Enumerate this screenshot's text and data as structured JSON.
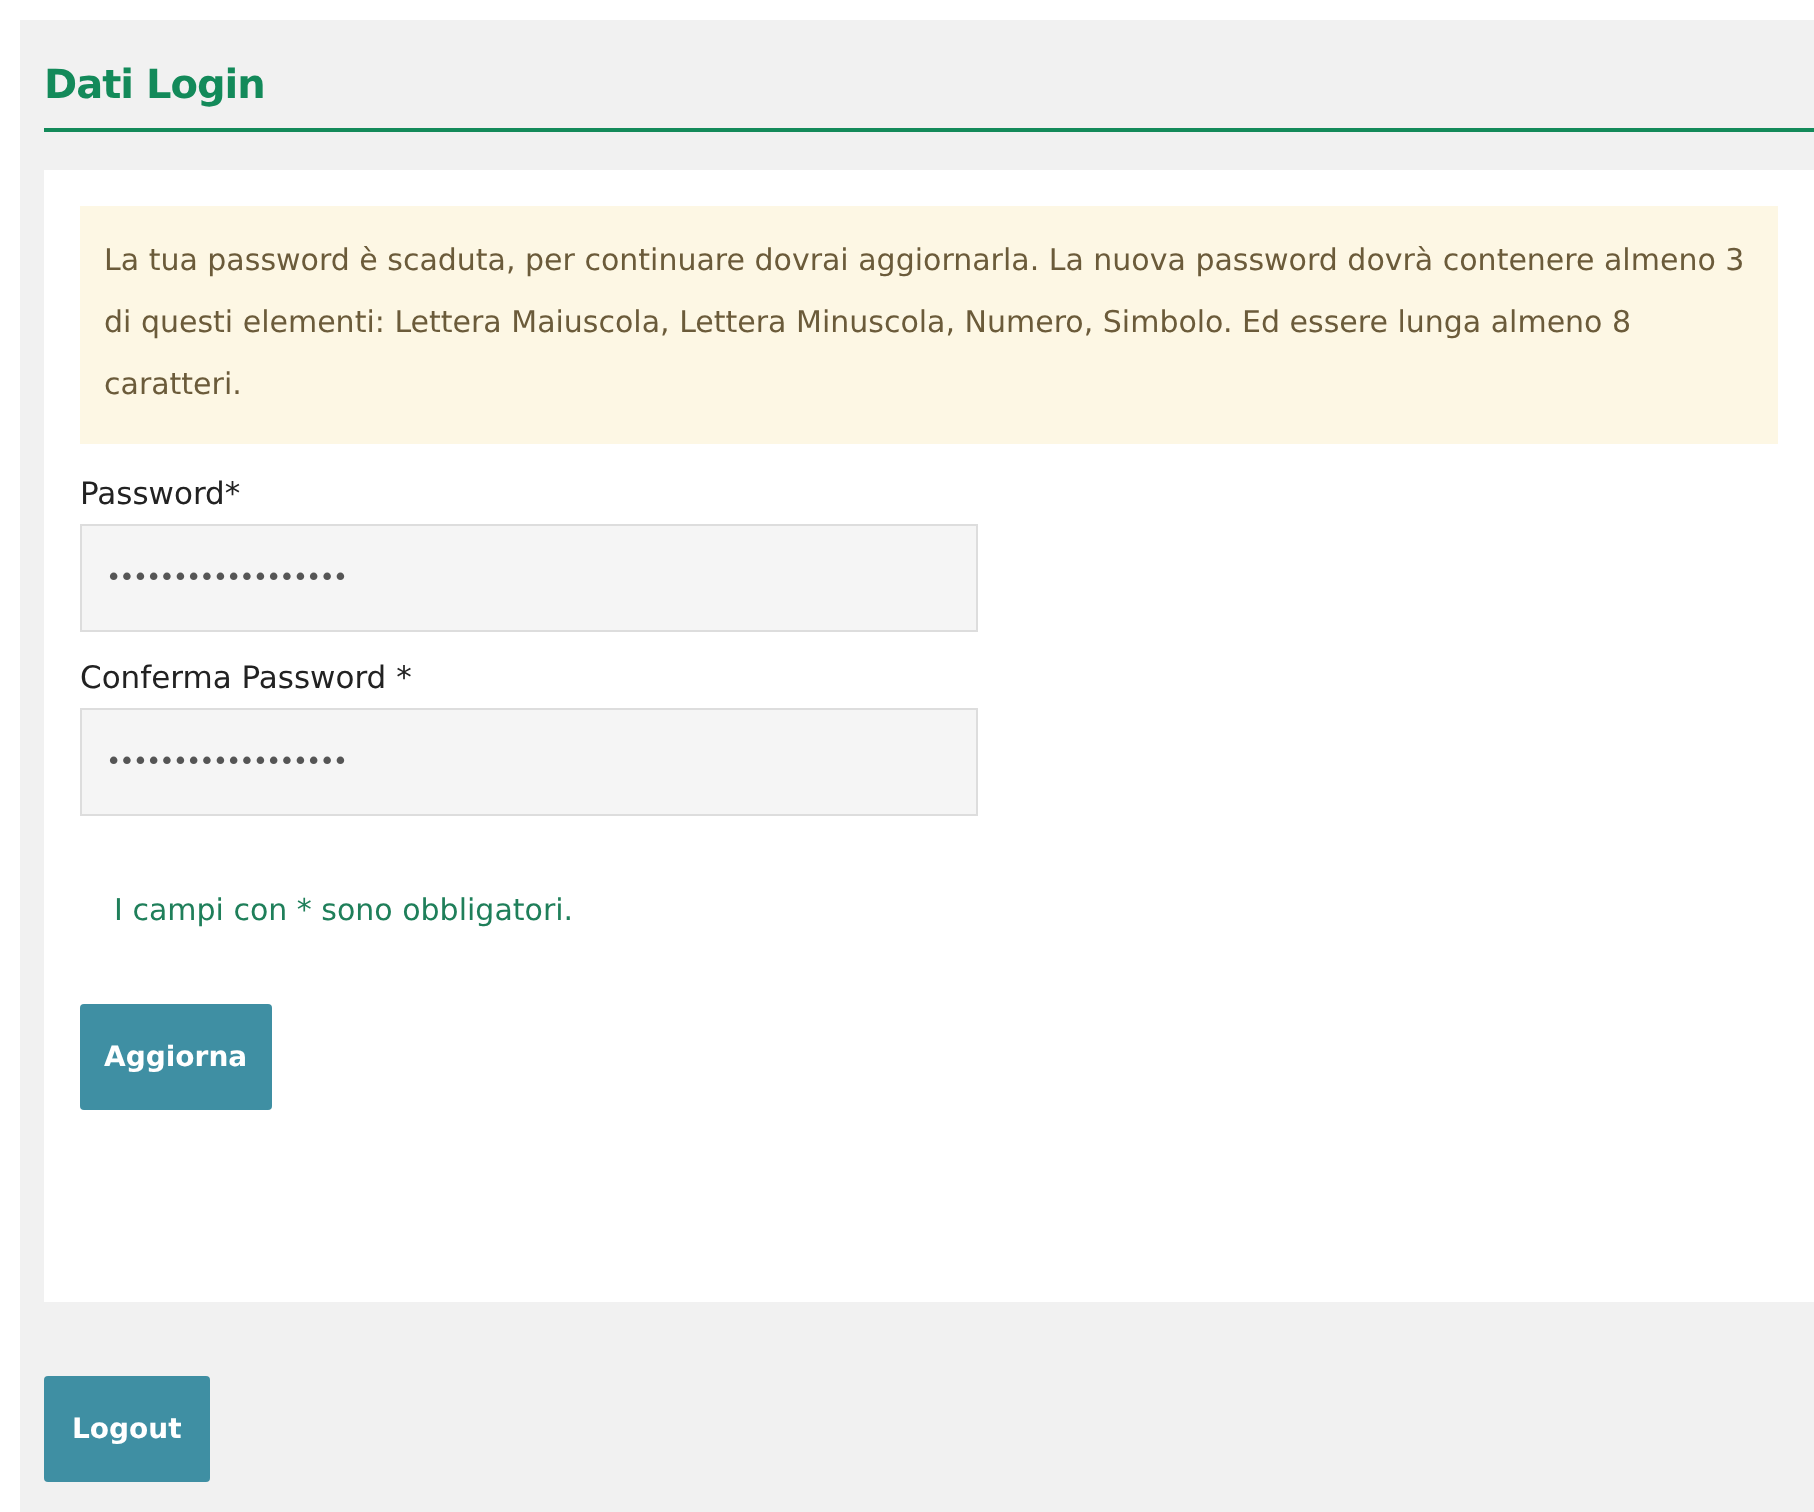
{
  "section": {
    "title": "Dati Login"
  },
  "alert": {
    "text": "La tua password è scaduta, per continuare dovrai aggiornarla. La nuova password dovrà contenere almeno 3 di questi elementi: Lettera Maiuscola, Lettera Minuscola, Numero, Simbolo. Ed essere lunga almeno 8 caratteri."
  },
  "fields": [
    {
      "label": "Password*",
      "value": "••••••••••••••••••"
    },
    {
      "label": "Conferma Password *",
      "value": "••••••••••••••••••"
    }
  ],
  "note": "I campi con * sono obbligatori.",
  "submit_button": "Aggiorna",
  "logout_button": "Logout"
}
